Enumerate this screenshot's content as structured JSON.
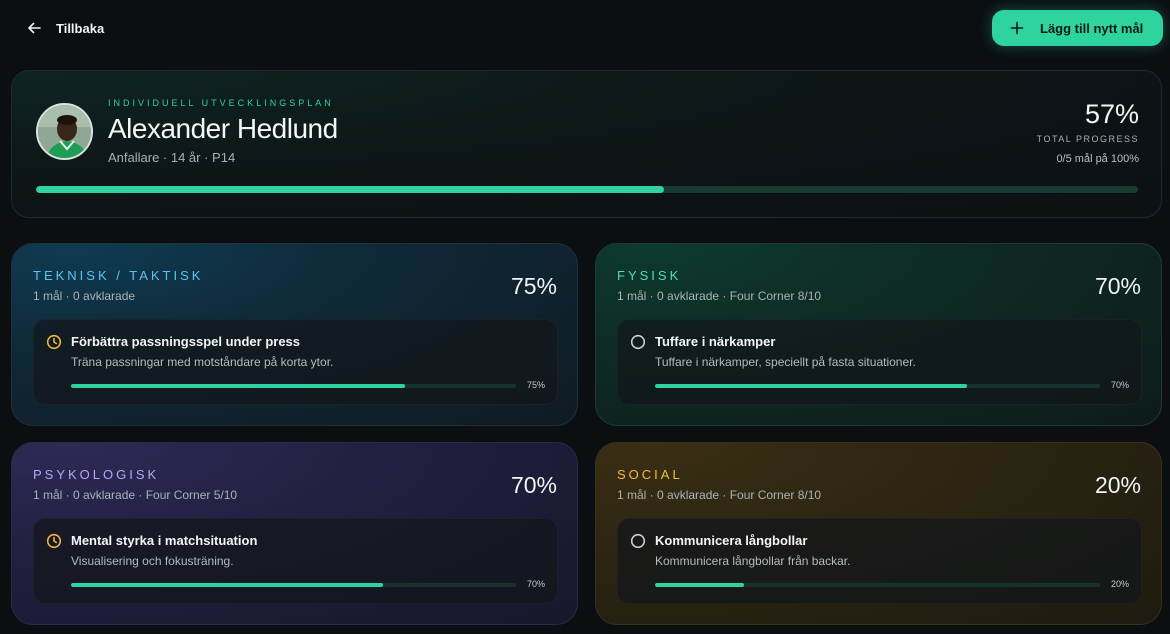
{
  "topbar": {
    "back_label": "Tillbaka",
    "add_label": "Lägg till nytt mål",
    "accent": "#2ed3a0"
  },
  "player": {
    "eyebrow": "INDIVIDUELL UTVECKLINGSPLAN",
    "name": "Alexander Hedlund",
    "meta": "Anfallare · 14 år · P14",
    "progress_text": "57%",
    "progress_value": 57,
    "progress_label": "TOTAL PROGRESS",
    "progress_sub": "0/5 mål på 100%"
  },
  "categories": [
    {
      "title": "TEKNISK / TAKTISK",
      "color": "#5cc4f2",
      "sub": "1 mål · 0 avklarade",
      "pct_text": "75%",
      "goal": {
        "icon": "clock-icon",
        "icon_color": "#f2b53b",
        "title": "Förbättra passningsspel under press",
        "desc": "Träna passningar med motståndare på korta ytor.",
        "pct_text": "75%",
        "value": 75
      }
    },
    {
      "title": "FYSISK",
      "color": "#4fe0b0",
      "sub": "1 mål · 0 avklarade · Four Corner 8/10",
      "pct_text": "70%",
      "goal": {
        "icon": "circle-icon",
        "icon_color": "#c9d0d3",
        "title": "Tuffare i närkamper",
        "desc": "Tuffare i närkamper, speciellt på fasta situationer.",
        "pct_text": "70%",
        "value": 70
      }
    },
    {
      "title": "PSYKOLOGISK",
      "color": "#b9a6f5",
      "sub": "1 mål · 0 avklarade · Four Corner 5/10",
      "pct_text": "70%",
      "goal": {
        "icon": "clock-icon",
        "icon_color": "#f2b53b",
        "title": "Mental styrka i matchsituation",
        "desc": "Visualisering och fokusträning.",
        "pct_text": "70%",
        "value": 70
      }
    },
    {
      "title": "SOCIAL",
      "color": "#f2bd3b",
      "sub": "1 mål · 0 avklarade · Four Corner 8/10",
      "pct_text": "20%",
      "goal": {
        "icon": "circle-icon",
        "icon_color": "#c9d0d3",
        "title": "Kommunicera långbollar",
        "desc": "Kommunicera långbollar från backar.",
        "pct_text": "20%",
        "value": 20
      }
    }
  ]
}
